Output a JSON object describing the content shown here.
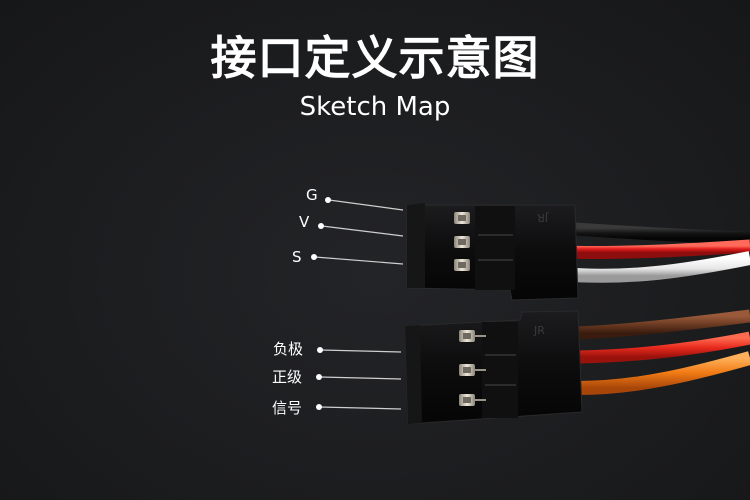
{
  "title": "接口定义示意图",
  "subtitle": "Sketch Map",
  "connector_top": {
    "marking": "JR",
    "pins": [
      {
        "label": "G",
        "wire_color": "#2a2a2a"
      },
      {
        "label": "V",
        "wire_color": "#e02424"
      },
      {
        "label": "S",
        "wire_color": "#f2f2f2"
      }
    ]
  },
  "connector_bottom": {
    "marking": "JR",
    "pins": [
      {
        "label": "负极",
        "wire_color": "#6b3a22"
      },
      {
        "label": "正级",
        "wire_color": "#e82a1e"
      },
      {
        "label": "信号",
        "wire_color": "#f07a14"
      }
    ]
  },
  "colors": {
    "background": "#1a1b1d",
    "text": "#ffffff",
    "leader_line": "#cfcfcf",
    "connector_body": "#0b0b0c",
    "pin_metal": "#c8c2b6"
  }
}
